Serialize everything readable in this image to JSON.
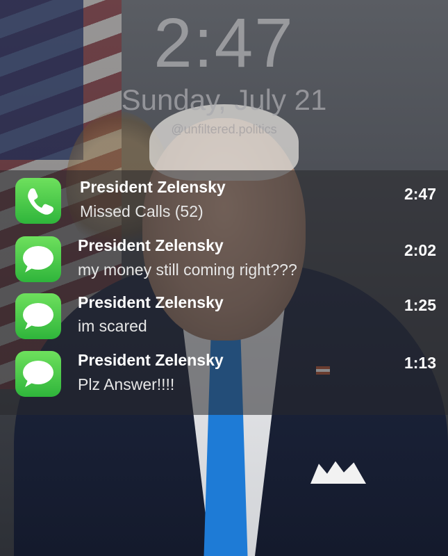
{
  "lockscreen": {
    "time": "2:47",
    "date": "Sunday, July 21",
    "watermark": "@unfiltered.politics"
  },
  "notifications": [
    {
      "app_icon": "phone-icon",
      "sender": "President Zelensky",
      "body": "Missed Calls (52)",
      "time": "2:47"
    },
    {
      "app_icon": "messages-icon",
      "sender": "President Zelensky",
      "body": "my money still coming right???",
      "time": "2:02"
    },
    {
      "app_icon": "messages-icon",
      "sender": "President Zelensky",
      "body": "im scared",
      "time": "1:25"
    },
    {
      "app_icon": "messages-icon",
      "sender": "President Zelensky",
      "body": "Plz Answer!!!!",
      "time": "1:13"
    }
  ],
  "colors": {
    "accent_green": "#34c759",
    "panel": "#28282c"
  }
}
